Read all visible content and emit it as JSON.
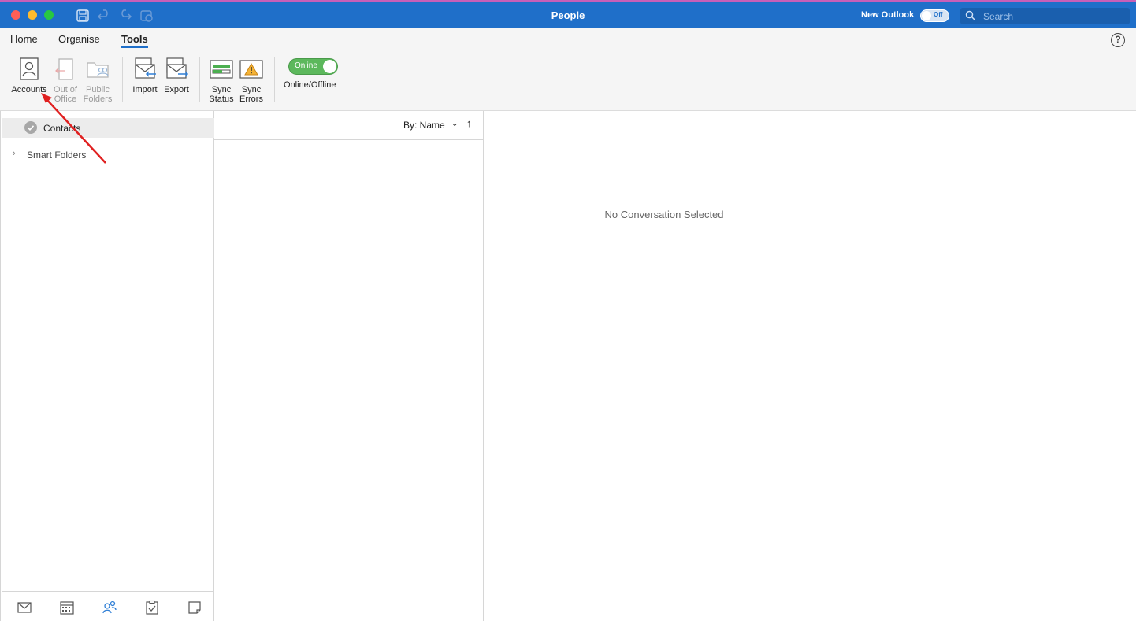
{
  "window": {
    "title": "People",
    "new_outlook_label": "New Outlook",
    "new_outlook_toggle": "Off",
    "search_placeholder": "Search"
  },
  "ribbon": {
    "tabs": [
      {
        "label": "Home",
        "active": false
      },
      {
        "label": "Organise",
        "active": false
      },
      {
        "label": "Tools",
        "active": true
      }
    ],
    "help_label": "?",
    "buttons": {
      "accounts": {
        "line1": "Accounts",
        "line2": ""
      },
      "out_of_office": {
        "line1": "Out of",
        "line2": "Office"
      },
      "public_folders": {
        "line1": "Public",
        "line2": "Folders"
      },
      "import": {
        "line1": "Import",
        "line2": ""
      },
      "export": {
        "line1": "Export",
        "line2": ""
      },
      "sync_status": {
        "line1": "Sync",
        "line2": "Status"
      },
      "sync_errors": {
        "line1": "Sync",
        "line2": "Errors"
      }
    },
    "online_toggle_label": "Online",
    "online_offline_caption": "Online/Offline"
  },
  "sidebar": {
    "contacts_label": "Contacts",
    "smart_folders_label": "Smart Folders",
    "smart_folders_chevron": "›",
    "nav_icons": [
      "mail-icon",
      "calendar-icon",
      "people-icon",
      "tasks-icon",
      "notes-icon"
    ]
  },
  "list": {
    "sort_label": "By: Name",
    "sort_chevron": "⌄",
    "sort_direction": "↑"
  },
  "reading": {
    "empty_message": "No Conversation Selected"
  },
  "colors": {
    "titlebar": "#1f6fc9",
    "accent": "#1f6fc9",
    "online_green": "#5cb85c",
    "annotation_arrow": "#e02020"
  }
}
